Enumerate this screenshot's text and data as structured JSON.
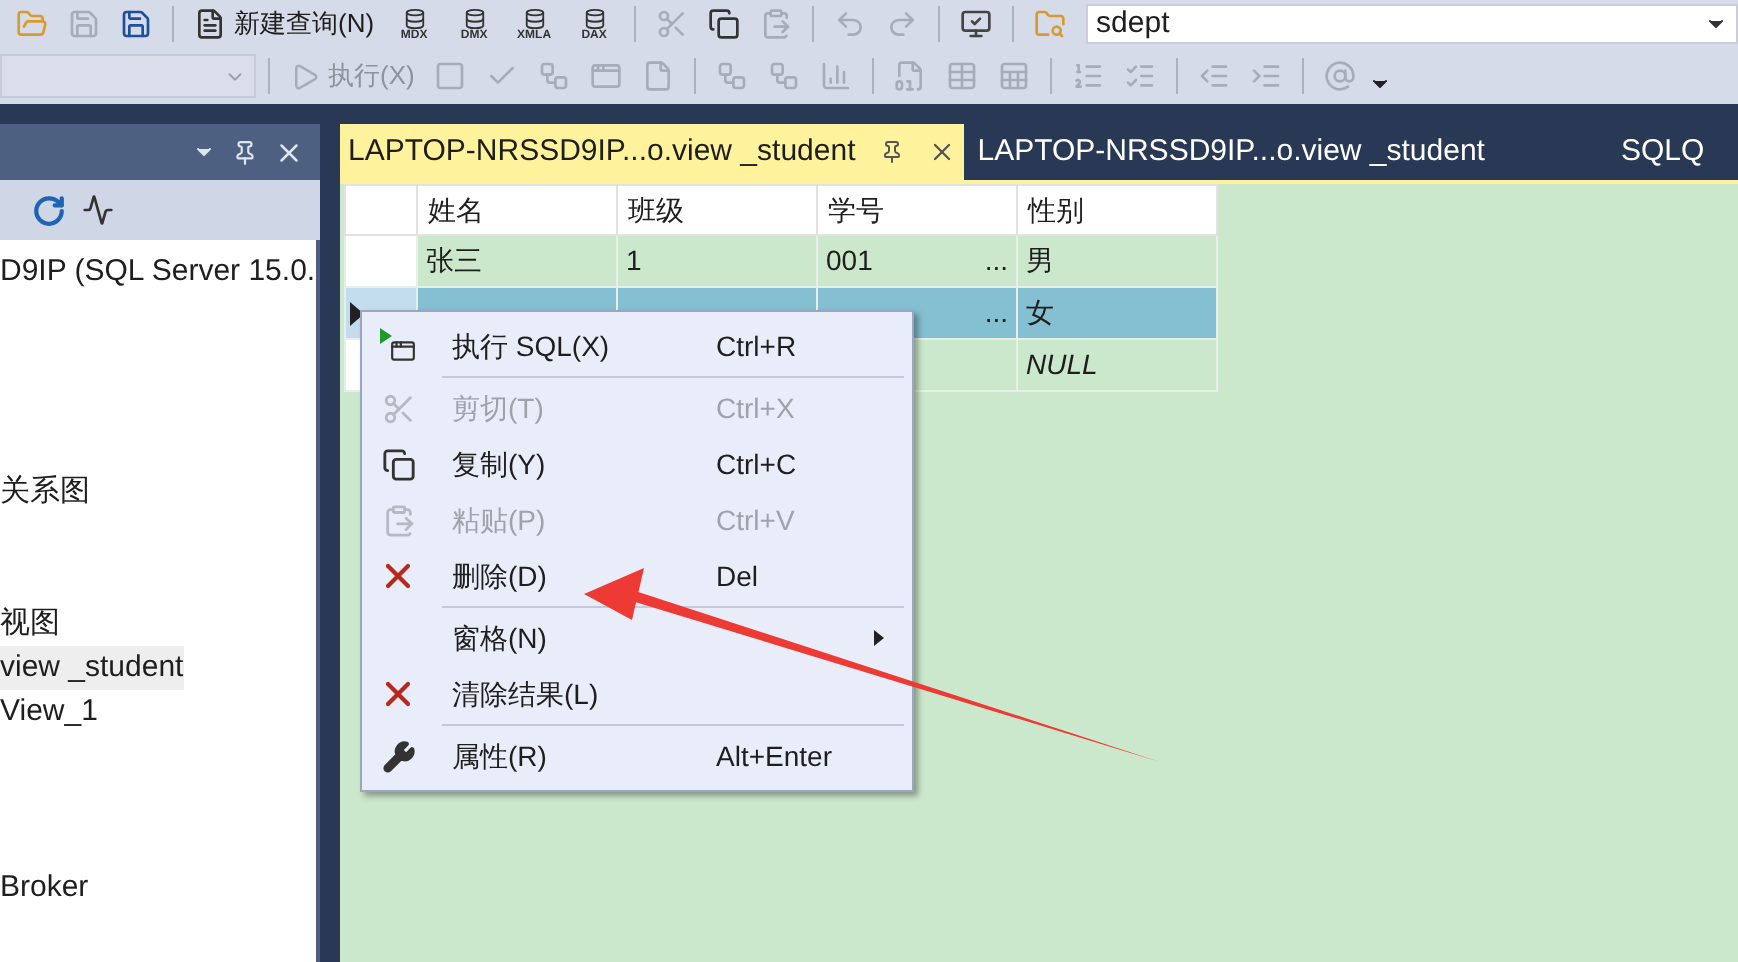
{
  "toolbar": {
    "items": [
      {
        "kind": "open",
        "disabled": false
      },
      {
        "kind": "save",
        "disabled": true
      },
      {
        "kind": "save-all",
        "disabled": false
      },
      {
        "kind": "separator"
      },
      {
        "kind": "new-query",
        "label": "新建查询(N)",
        "disabled": false
      },
      {
        "kind": "query",
        "label": "MDX",
        "disabled": false
      },
      {
        "kind": "query",
        "label": "DMX",
        "disabled": false
      },
      {
        "kind": "query",
        "label": "XMLA",
        "disabled": false
      },
      {
        "kind": "query",
        "label": "DAX",
        "disabled": false
      },
      {
        "kind": "separator"
      },
      {
        "kind": "cut",
        "disabled": true
      },
      {
        "kind": "copy",
        "disabled": false
      },
      {
        "kind": "paste",
        "disabled": true
      },
      {
        "kind": "separator"
      },
      {
        "kind": "undo",
        "disabled": true
      },
      {
        "kind": "redo",
        "disabled": true
      },
      {
        "kind": "separator"
      },
      {
        "kind": "monitor",
        "disabled": false
      },
      {
        "kind": "separator"
      },
      {
        "kind": "find-folder",
        "disabled": false
      }
    ],
    "database": {
      "value": "sdept"
    }
  },
  "sql_toolbar": {
    "items": [
      {
        "kind": "execute",
        "label": "执行(X)",
        "disabled": true
      },
      {
        "kind": "stop",
        "disabled": true
      },
      {
        "kind": "check",
        "disabled": true
      },
      {
        "kind": "plan",
        "disabled": true
      },
      {
        "kind": "window",
        "disabled": true
      },
      {
        "kind": "page",
        "disabled": true
      },
      {
        "kind": "separator"
      },
      {
        "kind": "plan",
        "disabled": true
      },
      {
        "kind": "plan",
        "disabled": true
      },
      {
        "kind": "chart",
        "disabled": true
      },
      {
        "kind": "separator"
      },
      {
        "kind": "results-text",
        "disabled": true
      },
      {
        "kind": "results-grid",
        "disabled": true
      },
      {
        "kind": "results-file",
        "disabled": true
      },
      {
        "kind": "separator"
      },
      {
        "kind": "comment",
        "disabled": true
      },
      {
        "kind": "uncomment",
        "disabled": true
      },
      {
        "kind": "separator"
      },
      {
        "kind": "outdent",
        "disabled": true
      },
      {
        "kind": "indent",
        "disabled": true
      },
      {
        "kind": "separator"
      },
      {
        "kind": "template",
        "disabled": true
      }
    ]
  },
  "explorer": {
    "tree": [
      {
        "kind": "node",
        "label": "D9IP (SQL Server 15.0.",
        "selected": false
      },
      {
        "kind": "blank"
      },
      {
        "kind": "blank"
      },
      {
        "kind": "blank"
      },
      {
        "kind": "blank"
      },
      {
        "kind": "node",
        "label": "关系图",
        "selected": false
      },
      {
        "kind": "blank"
      },
      {
        "kind": "blank"
      },
      {
        "kind": "node",
        "label": "视图",
        "selected": false
      },
      {
        "kind": "node",
        "label": "view _student",
        "selected": true
      },
      {
        "kind": "node",
        "label": "View_1",
        "selected": false
      },
      {
        "kind": "blank"
      },
      {
        "kind": "blank"
      },
      {
        "kind": "blank"
      },
      {
        "kind": "node",
        "label": "Broker",
        "selected": false
      }
    ]
  },
  "tabs": [
    {
      "label": "LAPTOP-NRSSD9IP...o.view _student",
      "selected": true
    },
    {
      "label": "LAPTOP-NRSSD9IP...o.view _student",
      "selected": false
    },
    {
      "label": "SQLQ",
      "selected": false
    }
  ],
  "grid": {
    "columns": [
      "姓名",
      "班级",
      "学号",
      "性别"
    ],
    "rows": [
      {
        "selected": false,
        "cells": [
          "张三",
          "1",
          "001",
          "男"
        ],
        "ellipsis": "..."
      },
      {
        "selected": true,
        "cells": [
          null,
          null,
          null,
          "女"
        ],
        "ellipsis": "..."
      },
      {
        "selected": false,
        "cells": [
          null,
          null,
          null,
          "NULL"
        ]
      }
    ]
  },
  "context_menu": {
    "items": [
      {
        "kind": "run",
        "label": "执行 SQL(X)",
        "shortcut": "Ctrl+R",
        "disabled": false
      },
      {
        "kind": "separator"
      },
      {
        "kind": "cut",
        "label": "剪切(T)",
        "shortcut": "Ctrl+X",
        "disabled": true
      },
      {
        "kind": "copy",
        "label": "复制(Y)",
        "shortcut": "Ctrl+C",
        "disabled": false
      },
      {
        "kind": "paste",
        "label": "粘贴(P)",
        "shortcut": "Ctrl+V",
        "disabled": true
      },
      {
        "kind": "delete",
        "label": "删除(D)",
        "shortcut": "Del",
        "disabled": false
      },
      {
        "kind": "separator"
      },
      {
        "kind": "submenu",
        "label": "窗格(N)",
        "disabled": false
      },
      {
        "kind": "delete",
        "label": "清除结果(L)",
        "disabled": false
      },
      {
        "kind": "separator"
      },
      {
        "kind": "properties",
        "label": "属性(R)",
        "shortcut": "Alt+Enter",
        "disabled": false
      }
    ]
  }
}
